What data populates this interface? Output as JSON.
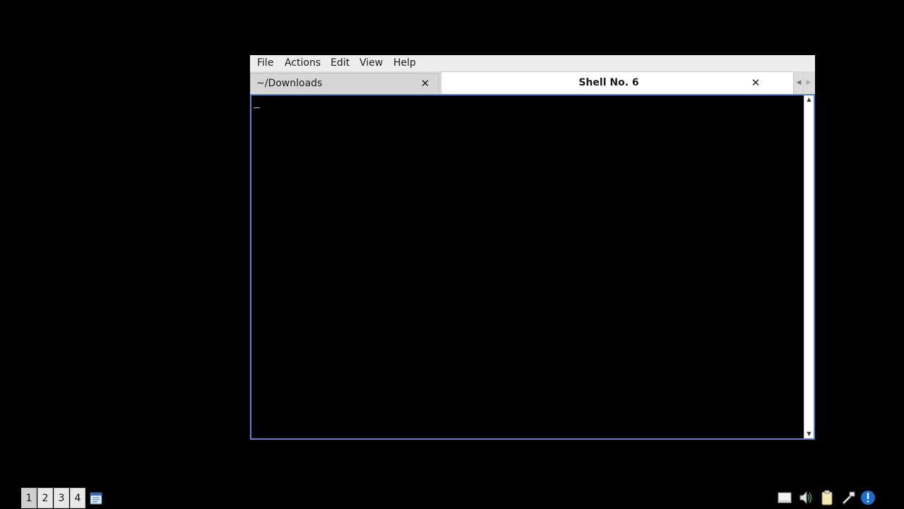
{
  "menubar": {
    "items": [
      "File",
      "Actions",
      "Edit",
      "View",
      "Help"
    ]
  },
  "tabs": [
    {
      "label": "~/Downloads",
      "active": false
    },
    {
      "label": "Shell No. 6",
      "active": true
    }
  ],
  "taskbar": {
    "workspaces": [
      "1",
      "2",
      "3",
      "4"
    ],
    "active_workspace": "1"
  },
  "tray": {
    "icons": [
      "drive-icon",
      "volume-icon",
      "clipboard-icon",
      "network-tools-icon",
      "notification-icon"
    ]
  },
  "colors": {
    "desktop": "#000000",
    "terminal_bg": "#000000",
    "focus_border": "#5b83c8",
    "notification": "#1c6fd0"
  }
}
